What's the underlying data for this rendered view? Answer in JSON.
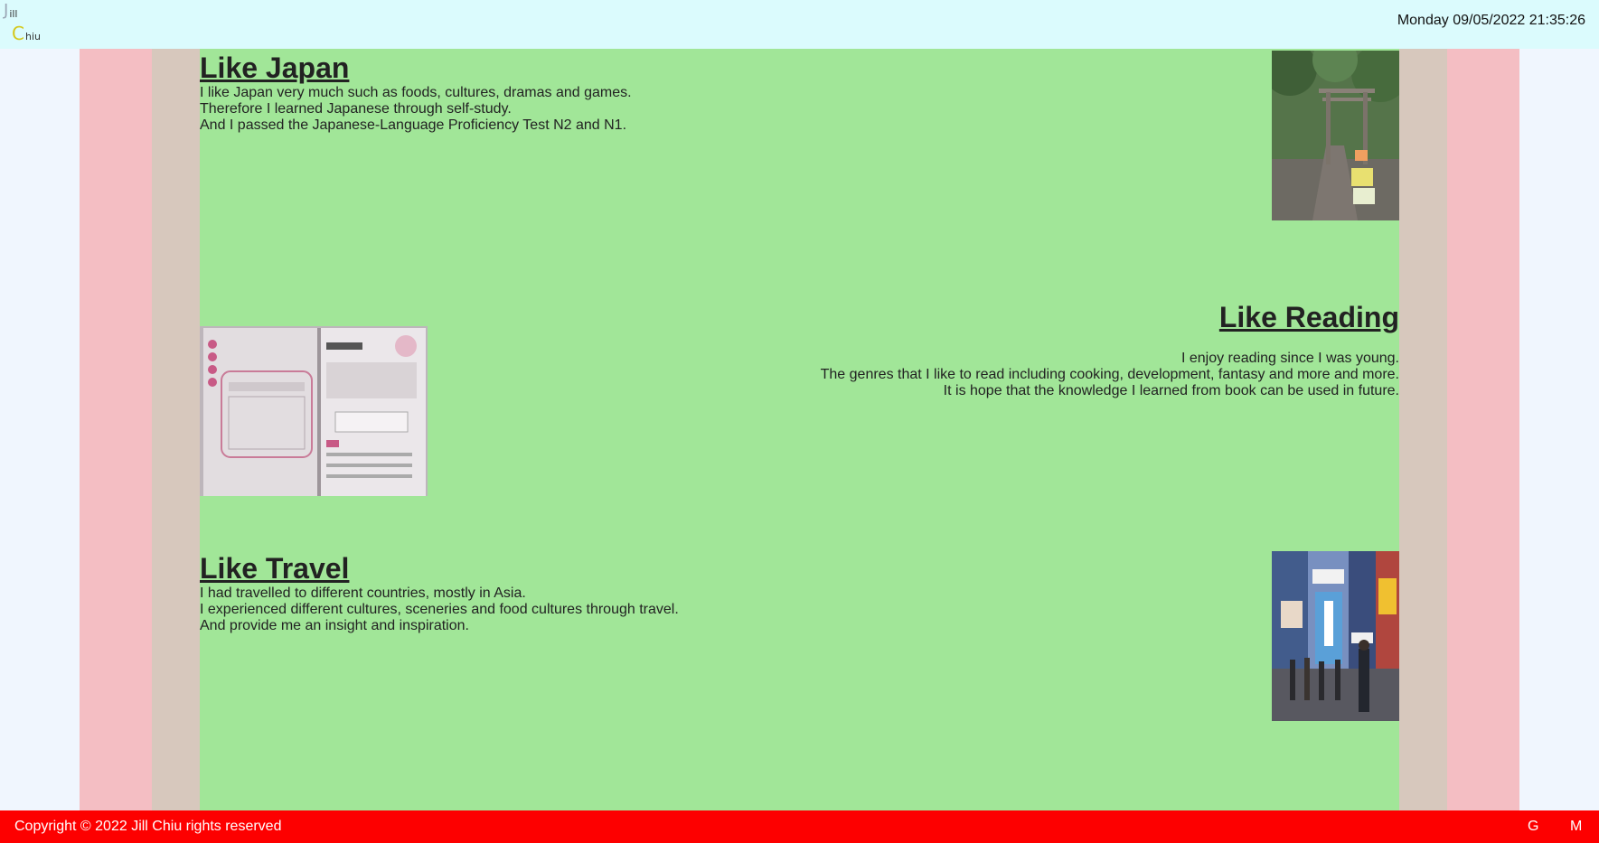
{
  "header": {
    "logo_line1_big": "J",
    "logo_line1_small": "ill",
    "logo_line2_big": "C",
    "logo_line2_small": "hiu",
    "datetime": "Monday 09/05/2022 21:35:26"
  },
  "sections": [
    {
      "title": "Like Japan",
      "lines": [
        "I like Japan very much such as foods, cultures, dramas and games.",
        "Therefore I learned Japanese through self-study.",
        "And I passed the Japanese-Language Proficiency Test N2 and N1."
      ]
    },
    {
      "title": "Like Reading",
      "lines": [
        "I enjoy reading since I was young.",
        "The genres that I like to read including cooking, development, fantasy and more and more.",
        "It is hope that the knowledge I learned from book can be used in future."
      ]
    },
    {
      "title": "Like Travel",
      "lines": [
        "I had travelled to different countries, mostly in Asia.",
        "I experienced different cultures, sceneries and food cultures through travel.",
        "And provide me an insight and inspiration."
      ]
    }
  ],
  "footer": {
    "copyright": "Copyright © 2022 Jill Chiu rights reserved",
    "link_g": "G",
    "link_m": "M"
  },
  "colors": {
    "header_bg": "#dbfbfd",
    "content_bg": "#a1e698",
    "outer_band": "#f4bec3",
    "inner_band": "#d7c8bd",
    "footer_bg": "#fd0000"
  }
}
